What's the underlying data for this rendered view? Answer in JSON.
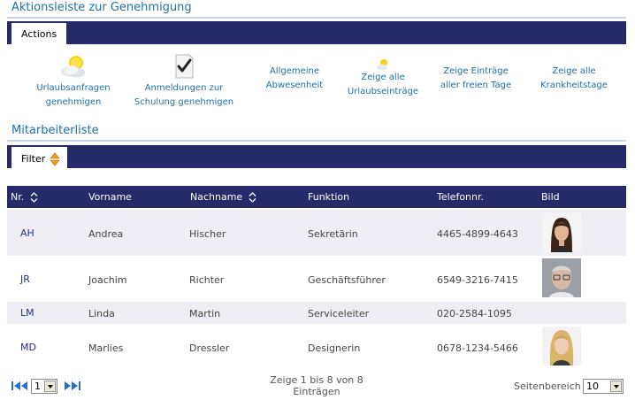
{
  "approval": {
    "title": "Aktionsleiste zur Genehmigung",
    "tab": "Actions",
    "actions": [
      {
        "line1": "Urlaubsanfragen",
        "line2": "genehmigen",
        "icon": "sun-cloud-icon"
      },
      {
        "line1": "Anmeldungen zur",
        "line2": "Schulung genehmigen",
        "icon": "checkmark-document-icon"
      },
      {
        "line1": "Allgemeine",
        "line2": "Abwesenheit",
        "icon": ""
      },
      {
        "line1": "Zeige alle",
        "line2": "Urlaubseinträge",
        "icon": "sun-cloud-icon"
      },
      {
        "line1": "Zeige Einträge",
        "line2": "aller freien Tage",
        "icon": ""
      },
      {
        "line1": "Zeige alle",
        "line2": "Krankheitstage",
        "icon": ""
      }
    ]
  },
  "employees": {
    "title": "Mitarbeiterliste",
    "filter_tab": "Filter",
    "columns": [
      "Nr.",
      "Vorname",
      "Nachname",
      "Funktion",
      "Telefonnr.",
      "Bild"
    ],
    "rows": [
      {
        "nr": "AH",
        "first": "Andrea",
        "last": "Hischer",
        "role": "Sekretärin",
        "phone": "4465-4899-4643",
        "photo": "female-dark-hair"
      },
      {
        "nr": "JR",
        "first": "Joachim",
        "last": "Richter",
        "role": "Geschäftsführer",
        "phone": "6549-3216-7415",
        "photo": "male-glasses"
      },
      {
        "nr": "LM",
        "first": "Linda",
        "last": "Martin",
        "role": "Serviceleiter",
        "phone": "020-2584-1095",
        "photo": ""
      },
      {
        "nr": "MD",
        "first": "Marlies",
        "last": "Dressler",
        "role": "Designerin",
        "phone": "0678-1234-5466",
        "photo": "female-blonde"
      }
    ]
  },
  "pager": {
    "page": "1",
    "info_line1": "Zeige 1 bis 8 von 8",
    "info_line2": "Einträgen",
    "range_label": "Seitenbereich",
    "range_value": "10"
  },
  "colors": {
    "header_bg": "#262a68",
    "link": "#1f6fa8",
    "alt_row": "#eeeef4"
  }
}
